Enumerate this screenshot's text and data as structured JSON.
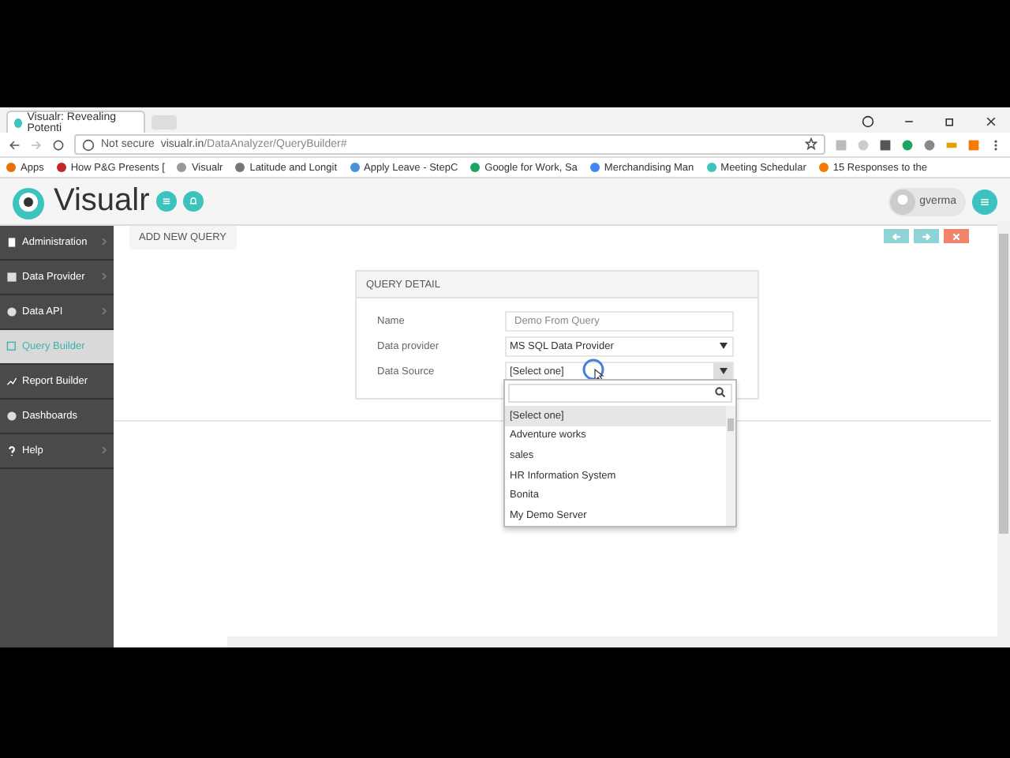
{
  "browser": {
    "tab_title": "Visualr: Revealing Potenti",
    "security": "Not secure",
    "url_host": "visualr.in",
    "url_path": "/DataAnalyzer/QueryBuilder#",
    "bookmarks": [
      {
        "label": "Apps"
      },
      {
        "label": "How P&G Presents ["
      },
      {
        "label": "Visualr"
      },
      {
        "label": "Latitude and Longit"
      },
      {
        "label": "Apply Leave - StepC"
      },
      {
        "label": "Google for Work, Sa"
      },
      {
        "label": "Merchandising Man"
      },
      {
        "label": "Meeting Schedular"
      },
      {
        "label": "15 Responses to the"
      }
    ]
  },
  "app": {
    "logo": "Visualr",
    "user": "gverma"
  },
  "sidebar": [
    {
      "label": "Administration",
      "selected": false,
      "arrow": true
    },
    {
      "label": "Data Provider",
      "selected": false,
      "arrow": true
    },
    {
      "label": "Data API",
      "selected": false,
      "arrow": true
    },
    {
      "label": "Query Builder",
      "selected": true,
      "arrow": false
    },
    {
      "label": "Report Builder",
      "selected": false,
      "arrow": false
    },
    {
      "label": "Dashboards",
      "selected": false,
      "arrow": false
    },
    {
      "label": "Help",
      "selected": false,
      "arrow": true
    }
  ],
  "tab": "ADD NEW QUERY",
  "panel": {
    "title": "QUERY DETAIL",
    "fields": [
      {
        "label": "Name",
        "kind": "input",
        "placeholder": "Demo From Query"
      },
      {
        "label": "Data provider",
        "kind": "select",
        "value": "MS SQL Data Provider"
      },
      {
        "label": "Data Source",
        "kind": "select",
        "value": "[Select one]"
      }
    ]
  },
  "dropdown": {
    "options": [
      {
        "label": "[Select one]",
        "selected": true
      },
      {
        "label": "Adventure works",
        "selected": false
      },
      {
        "label": "sales",
        "selected": false
      },
      {
        "label": "HR Information System",
        "selected": false
      },
      {
        "label": "Bonita",
        "selected": false
      },
      {
        "label": "My Demo Server",
        "selected": false
      }
    ]
  }
}
